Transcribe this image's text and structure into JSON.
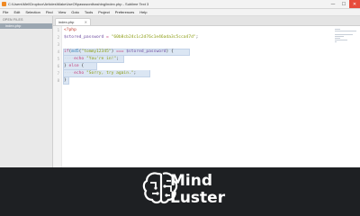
{
  "window": {
    "title": "C:\\Users\\Mel\\Dropbox\\Articles\\MakeUseOf\\passwordhashing\\index.php - Sublime Text 3",
    "controls": [
      "—",
      "☐",
      "✕"
    ]
  },
  "menu": [
    "File",
    "Edit",
    "Selection",
    "Find",
    "View",
    "Goto",
    "Tools",
    "Project",
    "Preferences",
    "Help"
  ],
  "sidebar": {
    "section_title": "OPEN FILES",
    "files": [
      "index.php"
    ]
  },
  "tabs": [
    {
      "label": "index.php",
      "close": "×"
    }
  ],
  "editor": {
    "line_numbers": [
      "1",
      "2",
      "3",
      "4",
      "5",
      "6",
      "7",
      "8"
    ],
    "lines": [
      {
        "parts": [
          {
            "t": "<?php",
            "c": "tag"
          }
        ]
      },
      {
        "parts": [
          {
            "t": "$stored_password",
            "c": "var"
          },
          {
            "t": " = ",
            "c": "op"
          },
          {
            "t": "\"60b8cb24c1c2d76c1e46ada3c5cca47d\"",
            "c": "str"
          },
          {
            "t": ";",
            "c": "plain"
          }
        ]
      },
      {
        "parts": []
      },
      {
        "parts": [
          {
            "t": "if",
            "c": "kw"
          },
          {
            "t": "(",
            "c": "plain"
          },
          {
            "t": "md5",
            "c": "fn"
          },
          {
            "t": "(",
            "c": "plain"
          },
          {
            "t": "\"tommy12345\"",
            "c": "str"
          },
          {
            "t": ") ",
            "c": "plain"
          },
          {
            "t": "===",
            "c": "op"
          },
          {
            "t": " $stored_password",
            "c": "var"
          },
          {
            "t": ") {",
            "c": "plain"
          }
        ]
      },
      {
        "parts": [
          {
            "t": "····",
            "c": "dots"
          },
          {
            "t": "echo",
            "c": "kw"
          },
          {
            "t": " ",
            "c": "plain"
          },
          {
            "t": "\"You're in!\"",
            "c": "str"
          },
          {
            "t": ";",
            "c": "plain"
          }
        ]
      },
      {
        "parts": [
          {
            "t": "} ",
            "c": "plain"
          },
          {
            "t": "else",
            "c": "kw"
          },
          {
            "t": " {",
            "c": "plain"
          }
        ]
      },
      {
        "parts": [
          {
            "t": "····",
            "c": "dots"
          },
          {
            "t": "echo",
            "c": "kw"
          },
          {
            "t": " ",
            "c": "plain"
          },
          {
            "t": "\"Sorry, try again.\"",
            "c": "str"
          },
          {
            "t": ";",
            "c": "plain"
          }
        ]
      },
      {
        "parts": [
          {
            "t": "}",
            "c": "plain"
          }
        ]
      }
    ]
  },
  "logo": {
    "word1": "Mind",
    "word2": "Luster",
    "icon": "brain-icon",
    "color": "#ffffff"
  },
  "colors": {
    "editor_bg": "#ffffff",
    "selection": "#dbe6f3",
    "stage_bg": "#1e2023"
  }
}
